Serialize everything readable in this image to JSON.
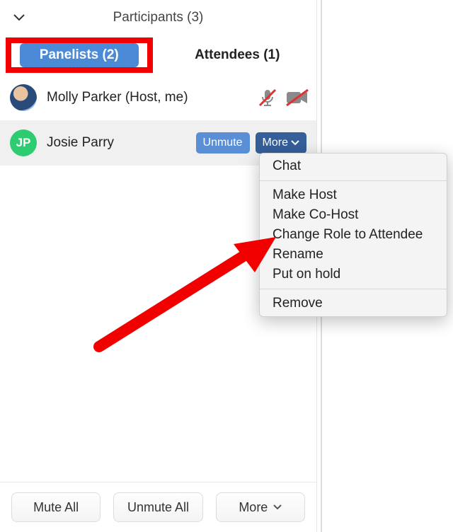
{
  "header": {
    "title": "Participants (3)"
  },
  "tabs": {
    "panelists": "Panelists (2)",
    "attendees": "Attendees (1)"
  },
  "participants": {
    "host": {
      "name": "Molly Parker (Host, me)"
    },
    "panelist": {
      "initials": "JP",
      "name": "Josie Parry",
      "unmute_label": "Unmute",
      "more_label": "More"
    }
  },
  "menu": {
    "chat": "Chat",
    "make_host": "Make Host",
    "make_cohost": "Make Co-Host",
    "change_role": "Change Role to Attendee",
    "rename": "Rename",
    "hold": "Put on hold",
    "remove": "Remove"
  },
  "footer": {
    "mute_all": "Mute All",
    "unmute_all": "Unmute All",
    "more": "More"
  },
  "colors": {
    "accent_blue": "#4a8ad6",
    "annotation_red": "#f20000",
    "avatar_green": "#2ecc71"
  }
}
